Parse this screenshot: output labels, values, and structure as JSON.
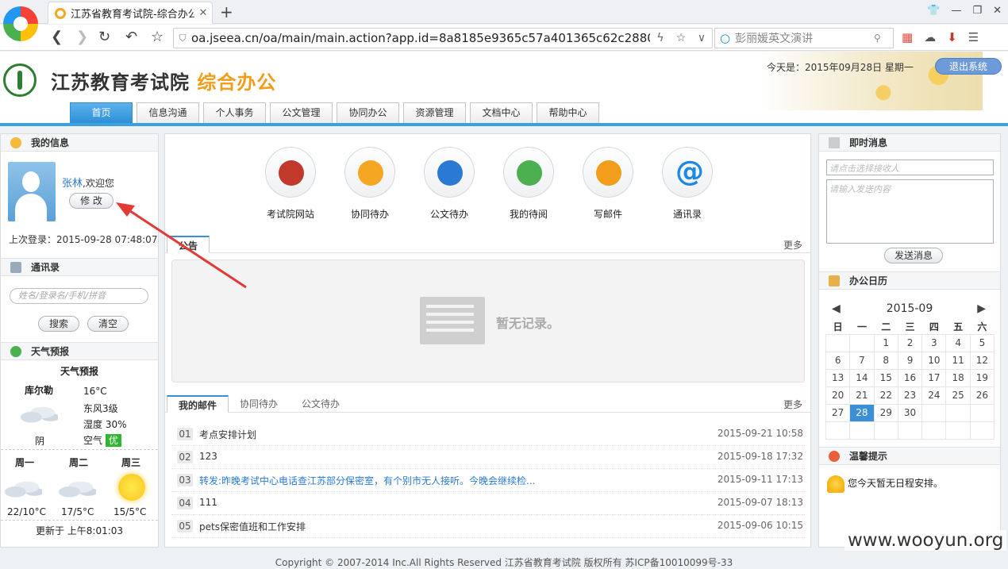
{
  "browser": {
    "tab_title": "江苏省教育考试院-综合办公",
    "url": "oa.jseea.cn/oa/main/main.action?app.id=8a8185e9365c57a401365c62c28800(",
    "search_placeholder": "彭丽媛英文演讲"
  },
  "header": {
    "title_main": "江苏教育考试院",
    "title_accent": "综合办公",
    "date_text": "今天是：2015年09月28日 星期一",
    "logout_label": "退出系统",
    "nav": [
      "首页",
      "信息沟通",
      "个人事务",
      "公文管理",
      "协同办公",
      "资源管理",
      "文档中心",
      "帮助中心"
    ]
  },
  "myinfo": {
    "title": "我的信息",
    "user_name": "张林",
    "welcome_suffix": ",欢迎您",
    "edit_label": "修 改",
    "last_login": "上次登录：2015-09-28 07:48:07"
  },
  "contacts": {
    "title": "通讯录",
    "placeholder": "姓名/登录名/手机/拼音",
    "search_label": "搜索",
    "clear_label": "清空"
  },
  "weather": {
    "title": "天气预报",
    "subtitle": "天气预报",
    "city": "库尔勒",
    "temp": "16°C",
    "wind": "东风3级",
    "humidity": "湿度 30%",
    "air_label": "空气",
    "air_value": "优",
    "condition": "阴",
    "days": [
      {
        "name": "周一",
        "range": "22/10°C",
        "icon": "cloud-icon"
      },
      {
        "name": "周二",
        "range": "17/5°C",
        "icon": "cloud-icon"
      },
      {
        "name": "周三",
        "range": "15/5°C",
        "icon": "sun-icon"
      }
    ],
    "updated": "更新于 上午8:01:03"
  },
  "quick_links": [
    "考试院网站",
    "协同待办",
    "公文待办",
    "我的待阅",
    "写邮件",
    "通讯录"
  ],
  "notice": {
    "tab": "公告",
    "more": "更多",
    "empty_text": "暂无记录。"
  },
  "mail_tabs": {
    "tabs": [
      "我的邮件",
      "协同待办",
      "公文待办"
    ],
    "more": "更多"
  },
  "mails": [
    {
      "no": "01",
      "subject": "考点安排计划",
      "date": "2015-09-21 10:58"
    },
    {
      "no": "02",
      "subject": "123",
      "date": "2015-09-18 17:32"
    },
    {
      "no": "03",
      "subject": "转发:昨晚考试中心电话查江苏部分保密室，有个别市无人接听。今晚会继续检...",
      "date": "2015-09-11 17:13"
    },
    {
      "no": "04",
      "subject": "111",
      "date": "2015-09-07 18:13"
    },
    {
      "no": "05",
      "subject": "pets保密值班和工作安排",
      "date": "2015-09-06 10:15"
    }
  ],
  "im": {
    "title": "即时消息",
    "receiver_placeholder": "请点击选择接收人",
    "content_placeholder": "请输入发送内容",
    "send_label": "发送消息"
  },
  "calendar": {
    "title": "办公日历",
    "month": "2015-09",
    "weekdays": [
      "日",
      "一",
      "二",
      "三",
      "四",
      "五",
      "六"
    ],
    "weeks": [
      [
        "",
        "",
        "1",
        "2",
        "3",
        "4",
        "5"
      ],
      [
        "6",
        "7",
        "8",
        "9",
        "10",
        "11",
        "12"
      ],
      [
        "13",
        "14",
        "15",
        "16",
        "17",
        "18",
        "19"
      ],
      [
        "20",
        "21",
        "22",
        "23",
        "24",
        "25",
        "26"
      ],
      [
        "27",
        "28",
        "29",
        "30",
        "",
        "",
        ""
      ],
      [
        "",
        "",
        "",
        "",
        "",
        "",
        ""
      ]
    ],
    "today": "28"
  },
  "tips": {
    "title": "温馨提示",
    "text": "您今天暂无日程安排。"
  },
  "footer": "Copyright © 2007-2014 Inc.All Rights Reserved     江苏省教育考试院 版权所有 苏ICP备10010099号-33",
  "watermark": "www.wooyun.org"
}
